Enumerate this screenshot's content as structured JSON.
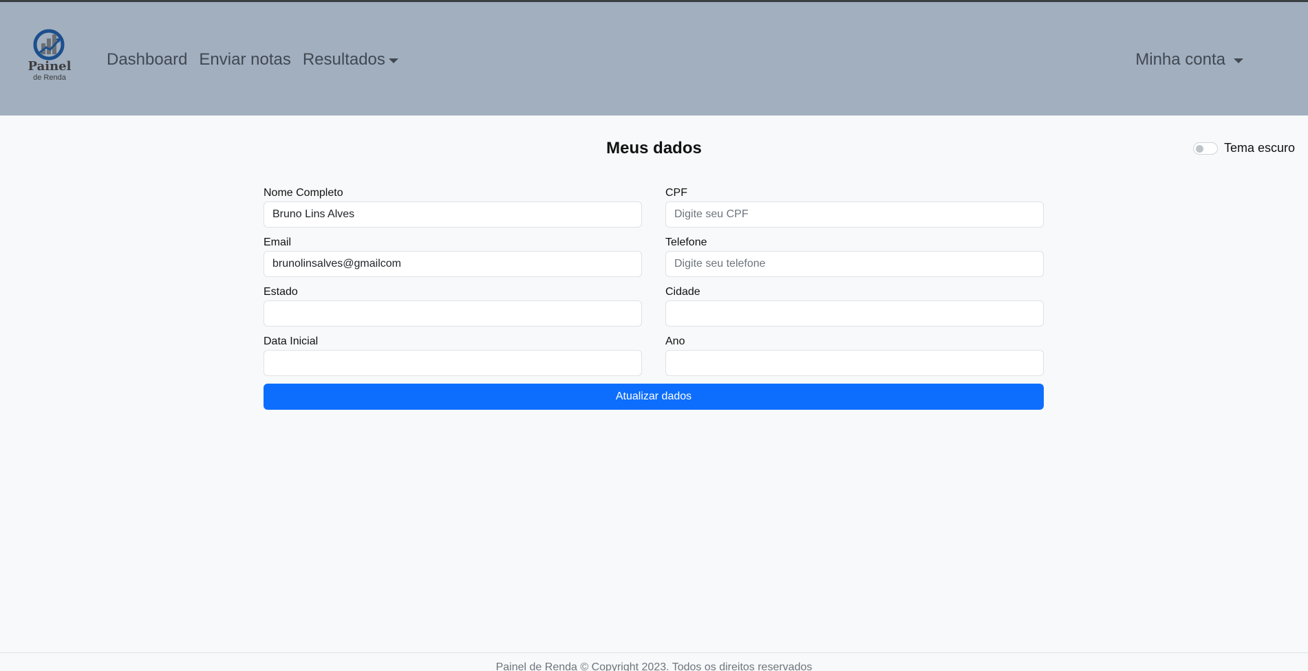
{
  "brand": {
    "logo_title": "Painel",
    "logo_subtitle": "de Renda"
  },
  "nav": {
    "items": [
      {
        "label": "Dashboard"
      },
      {
        "label": "Enviar notas"
      },
      {
        "label": "Resultados"
      }
    ],
    "account_label": "Minha conta"
  },
  "page": {
    "title": "Meus dados",
    "theme_toggle_label": "Tema escuro"
  },
  "form": {
    "full_name": {
      "label": "Nome Completo",
      "value": "Bruno Lins Alves",
      "placeholder": ""
    },
    "cpf": {
      "label": "CPF",
      "value": "",
      "placeholder": "Digite seu CPF"
    },
    "email": {
      "label": "Email",
      "value": "brunolinsalves@gmailcom",
      "placeholder": ""
    },
    "phone": {
      "label": "Telefone",
      "value": "",
      "placeholder": "Digite seu telefone"
    },
    "state": {
      "label": "Estado",
      "value": "",
      "placeholder": ""
    },
    "city": {
      "label": "Cidade",
      "value": "",
      "placeholder": ""
    },
    "start_date": {
      "label": "Data Inicial",
      "value": "",
      "placeholder": ""
    },
    "year": {
      "label": "Ano",
      "value": "",
      "placeholder": ""
    },
    "submit_label": "Atualizar dados"
  },
  "footer": {
    "text": "Painel de Renda © Copyright 2023. Todos os direitos reservados"
  },
  "colors": {
    "navbar_bg": "#a1afbf",
    "primary_button": "#0d6efd",
    "logo_blue": "#1c4f8c"
  },
  "icons": {
    "logo": "chart-growth-logo-icon",
    "dropdown": "caret-down-icon"
  }
}
